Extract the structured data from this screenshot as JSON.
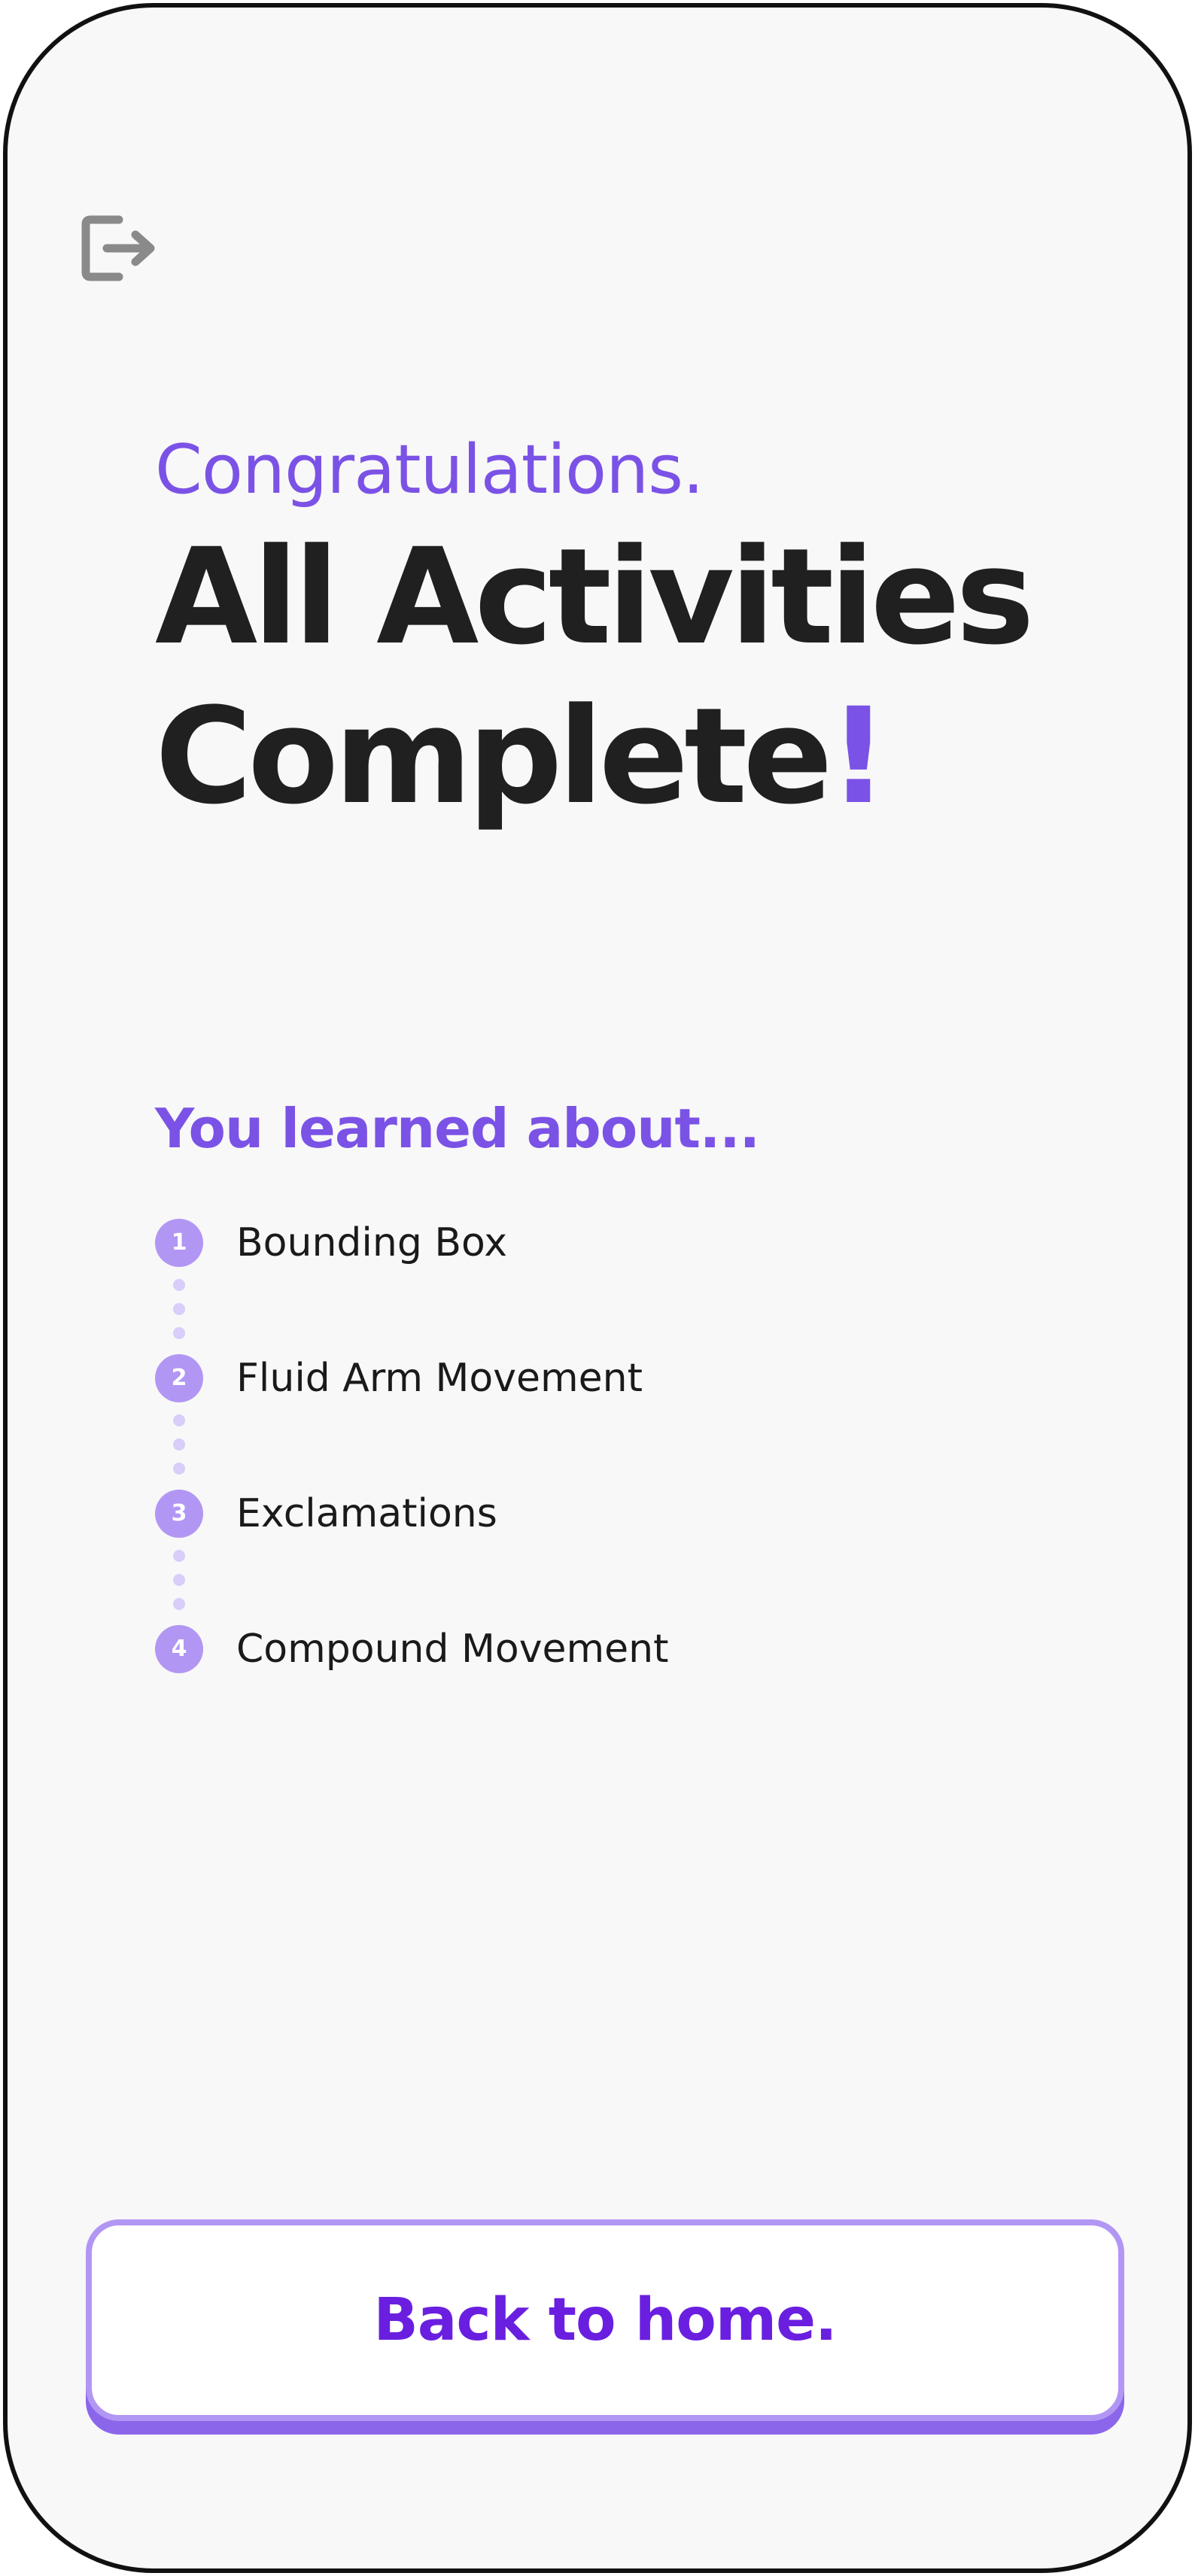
{
  "header": {
    "exit_icon": "logout-icon"
  },
  "hero": {
    "subtitle": "Congratulations.",
    "title_line1": "All Activities",
    "title_line2_word": "Complete",
    "title_line2_mark": "!"
  },
  "summary": {
    "heading": "You learned about...",
    "items": [
      {
        "number": "1",
        "label": "Bounding Box"
      },
      {
        "number": "2",
        "label": "Fluid Arm Movement"
      },
      {
        "number": "3",
        "label": "Exclamations"
      },
      {
        "number": "4",
        "label": "Compound Movement"
      }
    ]
  },
  "footer": {
    "home_button_label": "Back to home."
  },
  "colors": {
    "accent": "#7b52e6",
    "accent_light": "#b296f4",
    "button_text": "#6a1fe0",
    "title_text": "#202020",
    "background": "#f8f8f8"
  }
}
